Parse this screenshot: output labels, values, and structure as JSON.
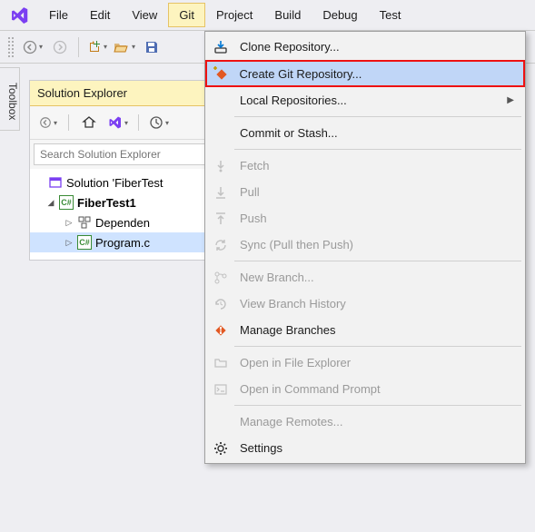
{
  "menubar": {
    "items": [
      "File",
      "Edit",
      "View",
      "Git",
      "Project",
      "Build",
      "Debug",
      "Test"
    ],
    "open_index": 3
  },
  "toolbox_tab": "Toolbox",
  "solution_explorer": {
    "title": "Solution Explorer",
    "search_placeholder": "Search Solution Explorer",
    "tree": {
      "solution": "Solution 'FiberTest",
      "project": "FiberTest1",
      "dependencies": "Dependen",
      "program": "Program.c"
    }
  },
  "git_menu": {
    "clone": "Clone Repository...",
    "create": "Create Git Repository...",
    "local": "Local Repositories...",
    "commit": "Commit or Stash...",
    "fetch": "Fetch",
    "pull": "Pull",
    "push": "Push",
    "sync": "Sync (Pull then Push)",
    "new_branch": "New Branch...",
    "history": "View Branch History",
    "manage_branches": "Manage Branches",
    "open_explorer": "Open in File Explorer",
    "open_cmd": "Open in Command Prompt",
    "manage_remotes": "Manage Remotes...",
    "settings": "Settings"
  }
}
